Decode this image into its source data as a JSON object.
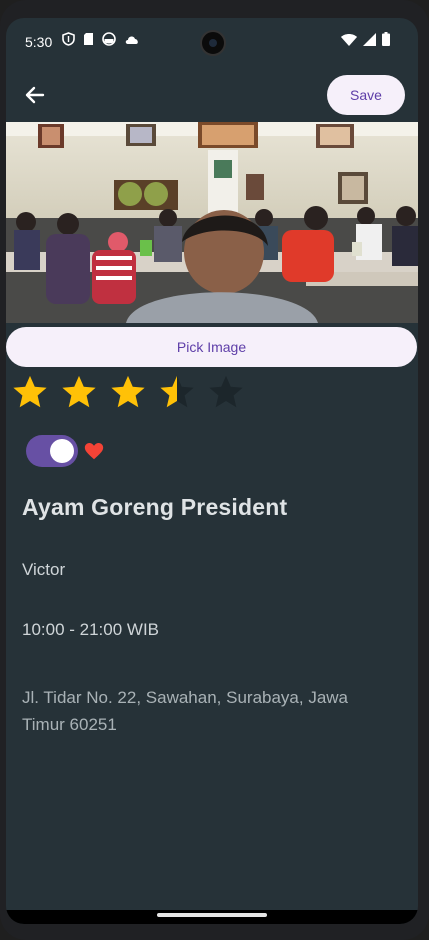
{
  "status_bar": {
    "time": "5:30",
    "left_icons": [
      "shield-icon",
      "sim-card-icon",
      "android-icon",
      "cloud-icon"
    ],
    "right_icons": [
      "wifi-icon",
      "signal-icon",
      "battery-icon"
    ]
  },
  "app_bar": {
    "back_icon": "arrow-left-icon",
    "save_label": "Save"
  },
  "photo": {
    "description_icon": "restaurant-photo"
  },
  "pick_image_label": "Pick Image",
  "rating": {
    "value": 3.5,
    "max": 5,
    "filled_color": "#ffc107",
    "empty_color": "#1c262b"
  },
  "favorite": {
    "toggle_on": true,
    "toggle_color": "#6750a4",
    "heart_color": "#f44336"
  },
  "restaurant": {
    "name": "Ayam Goreng President",
    "owner": "Victor",
    "hours": "10:00 - 21:00 WIB",
    "address": "Jl. Tidar No. 22, Sawahan, Surabaya, Jawa Timur 60251"
  },
  "colors": {
    "background": "#263238",
    "button_bg": "#f6f0fa",
    "button_text": "#5e3ea8"
  }
}
